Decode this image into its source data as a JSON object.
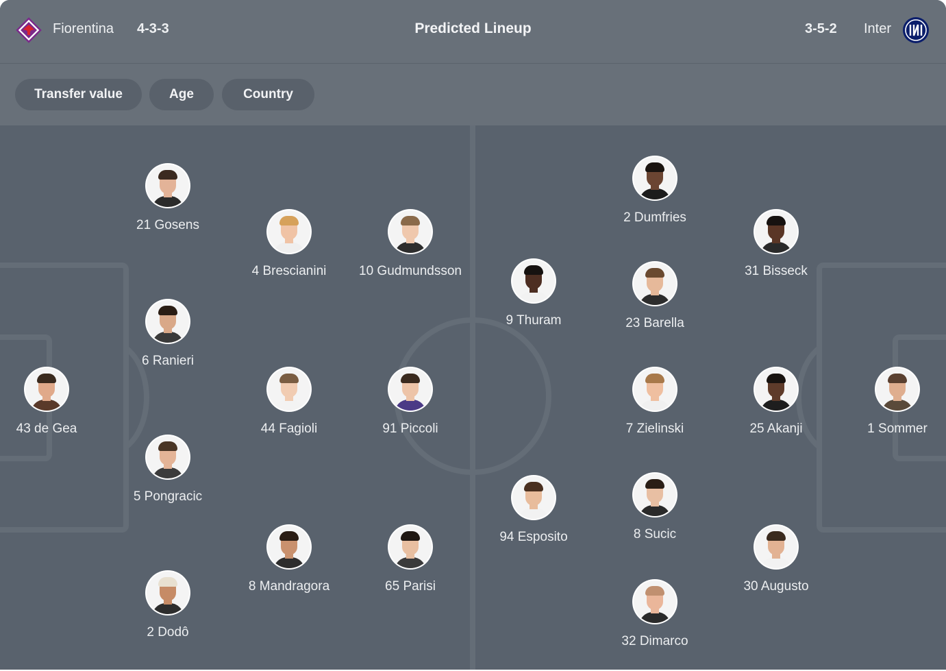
{
  "header": {
    "title": "Predicted Lineup",
    "home": {
      "name": "Fiorentina",
      "formation": "4-3-3"
    },
    "away": {
      "name": "Inter",
      "formation": "3-5-2"
    }
  },
  "filters": [
    "Transfer value",
    "Age",
    "Country"
  ],
  "colors": {
    "card": "#59626d",
    "header": "#687079",
    "pitch_lines": "#646d77",
    "fiorentina_brand": "#7b2a8a",
    "inter_brand": "#0b1e6b"
  },
  "home_players": [
    {
      "label": "21 Gosens",
      "skin": "#e3b398",
      "hair": "#3b2a20",
      "shirt": "#2b2b2b"
    },
    {
      "label": "4 Brescianini",
      "skin": "#f0c3a5",
      "hair": "#d6a15a",
      "shirt": "#efefef"
    },
    {
      "label": "10 Gudmundsson",
      "skin": "#efc8ad",
      "hair": "#8a6a4a",
      "shirt": "#2d2d2d"
    },
    {
      "label": "6 Ranieri",
      "skin": "#d9a888",
      "hair": "#2a1d14",
      "shirt": "#3a3a3a"
    },
    {
      "label": "43 de Gea",
      "skin": "#e0a98a",
      "hair": "#3a2a1e",
      "shirt": "#5a3a2a"
    },
    {
      "label": "44 Fagioli",
      "skin": "#f1ccb2",
      "hair": "#7a5d42",
      "shirt": "#f3f3f3"
    },
    {
      "label": "91 Piccoli",
      "skin": "#edc4a8",
      "hair": "#3a2a1e",
      "shirt": "#4b3a86"
    },
    {
      "label": "5 Pongracic",
      "skin": "#e4b497",
      "hair": "#4a3626",
      "shirt": "#3b3b3b"
    },
    {
      "label": "8 Mandragora",
      "skin": "#c9916e",
      "hair": "#2a1d14",
      "shirt": "#2d2d2d"
    },
    {
      "label": "65 Parisi",
      "skin": "#e8bfa1",
      "hair": "#1f1712",
      "shirt": "#3a3a3a"
    },
    {
      "label": "2 Dodô",
      "skin": "#c68b66",
      "hair": "#e8e0d0",
      "shirt": "#2d2d2d"
    }
  ],
  "away_players": [
    {
      "label": "2 Dumfries",
      "skin": "#6b4532",
      "hair": "#1a1410",
      "shirt": "#1c1c1c"
    },
    {
      "label": "31 Bisseck",
      "skin": "#5a3626",
      "hair": "#161210",
      "shirt": "#2a2a2a"
    },
    {
      "label": "9 Thuram",
      "skin": "#4d2e22",
      "hair": "#161210",
      "shirt": "#f2f2f2"
    },
    {
      "label": "23 Barella",
      "skin": "#e6b99a",
      "hair": "#6a4a30",
      "shirt": "#2d2d2d"
    },
    {
      "label": "7 Zielinski",
      "skin": "#efbfa0",
      "hair": "#a8794a",
      "shirt": "#f0f0f0"
    },
    {
      "label": "25 Akanji",
      "skin": "#5e3b2a",
      "hair": "#181310",
      "shirt": "#1e1e1e"
    },
    {
      "label": "1 Sommer",
      "skin": "#dfae8f",
      "hair": "#5a4030",
      "shirt": "#5a4a3a"
    },
    {
      "label": "94 Esposito",
      "skin": "#e8bc9c",
      "hair": "#4a3020",
      "shirt": "#f2f2f2"
    },
    {
      "label": "8 Sucic",
      "skin": "#e8bfa3",
      "hair": "#2a1e16",
      "shirt": "#2a2a2a"
    },
    {
      "label": "30 Augusto",
      "skin": "#e2b293",
      "hair": "#3a2a1e",
      "shirt": "#f2f2f2"
    },
    {
      "label": "32 Dimarco",
      "skin": "#eab69a",
      "hair": "#c09070",
      "shirt": "#2a2a2a"
    }
  ]
}
